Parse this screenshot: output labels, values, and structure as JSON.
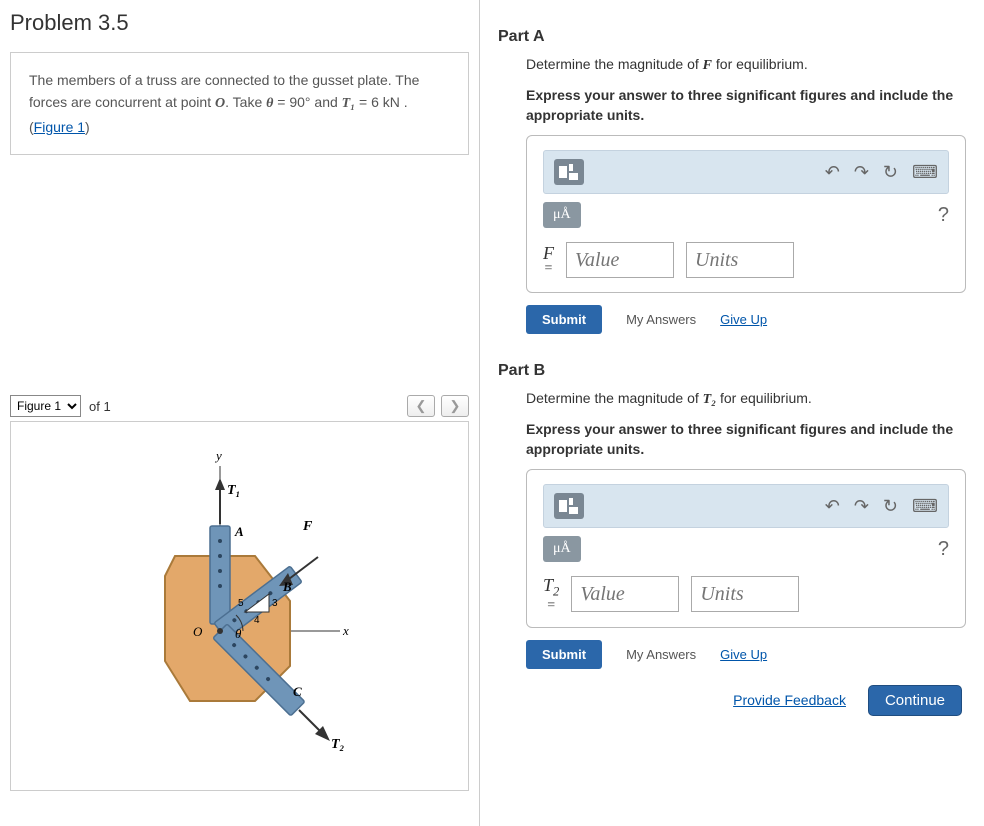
{
  "title": "Problem 3.5",
  "prompt": {
    "text1": "The members of a truss are connected to the gusset plate. The forces are concurrent at point ",
    "pointO": "O",
    "text2": ". Take ",
    "thetaVar": "θ",
    "text3": " = 90° and ",
    "t1var": "T₁",
    "text4": " = 6  kN . (",
    "figlink": "Figure 1",
    "text5": ")"
  },
  "figure": {
    "selector": "Figure 1",
    "of": "of 1",
    "labels": {
      "y": "y",
      "x": "x",
      "T1": "T₁",
      "T2": "T₂",
      "F": "F",
      "A": "A",
      "B": "B",
      "C": "C",
      "O": "O",
      "theta": "θ",
      "n5": "5",
      "n3": "3",
      "n4": "4"
    }
  },
  "partA": {
    "head": "Part A",
    "q1": "Determine the magnitude of ",
    "qvar": "F",
    "q2": " for equilibrium.",
    "instr": "Express your answer to three significant figures and include the appropriate units.",
    "unitsChip": "μÅ",
    "var": "F",
    "eq": "=",
    "valuePH": "Value",
    "unitsPH": "Units",
    "submit": "Submit",
    "myAnswers": "My Answers",
    "giveUp": "Give Up"
  },
  "partB": {
    "head": "Part B",
    "q1": "Determine the magnitude of ",
    "qvar": "T₂",
    "q2": " for equilibrium.",
    "instr": "Express your answer to three significant figures and include the appropriate units.",
    "unitsChip": "μÅ",
    "var": "T₂",
    "eq": "=",
    "valuePH": "Value",
    "unitsPH": "Units",
    "submit": "Submit",
    "myAnswers": "My Answers",
    "giveUp": "Give Up"
  },
  "footer": {
    "provide": "Provide Feedback",
    "cont": "Continue"
  }
}
